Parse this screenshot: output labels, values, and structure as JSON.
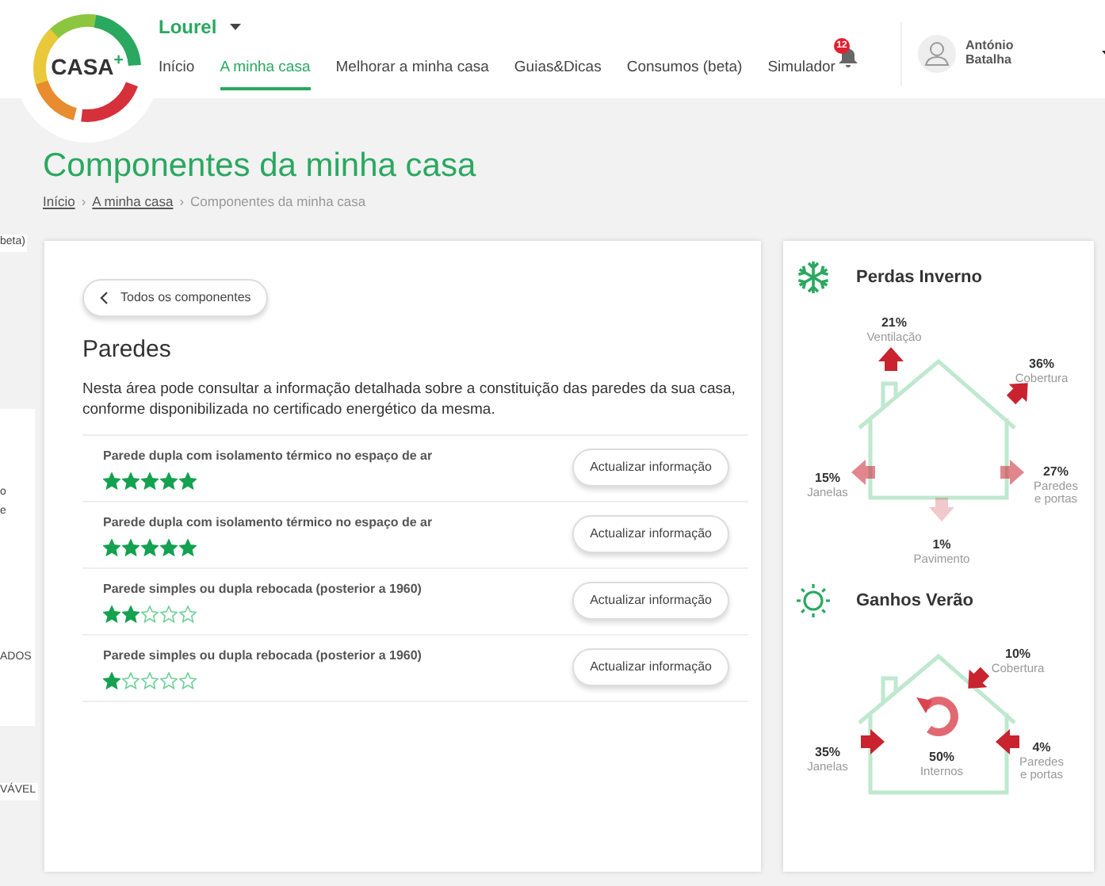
{
  "header": {
    "logo": {
      "text": "CASA",
      "sup": "+"
    },
    "location": "Lourel",
    "nav": [
      {
        "label": "Início",
        "selected": false
      },
      {
        "label": "A minha casa",
        "selected": true
      },
      {
        "label": "Melhorar a minha casa",
        "selected": false
      },
      {
        "label": "Guias&Dicas",
        "selected": false
      },
      {
        "label": "Consumos (beta)",
        "selected": false
      },
      {
        "label": "Simulador",
        "selected": false
      }
    ],
    "notifications": "12",
    "user": "António Batalha"
  },
  "side_fragments": [
    "beta)",
    "o",
    "e",
    "ADOS",
    "VÁVEL"
  ],
  "page": {
    "title": "Componentes da minha casa",
    "breadcrumb": [
      "Início",
      "A minha casa",
      "Componentes da minha casa"
    ],
    "breadcrumb_separators": [
      "›",
      "›"
    ]
  },
  "component": {
    "back": "Todos os componentes",
    "title": "Paredes",
    "description": "Nesta área pode consultar a informação detalhada sobre a constituição das paredes da sua casa, conforme disponibilizada no certificado energético da mesma.",
    "items": [
      {
        "name": "Parede dupla com isolamento térmico no espaço de ar",
        "stars": 5,
        "action": "Actualizar informação"
      },
      {
        "name": "Parede dupla com isolamento térmico no espaço de ar",
        "stars": 5,
        "action": "Actualizar informação"
      },
      {
        "name": "Parede simples ou dupla rebocada (posterior a 1960)",
        "stars": 2,
        "action": "Actualizar informação"
      },
      {
        "name": "Parede simples ou dupla rebocada (posterior a 1960)",
        "stars": 1,
        "action": "Actualizar informação"
      }
    ]
  },
  "panels": [
    {
      "kind": "winter",
      "title": "Perdas Inverno",
      "flows": [
        {
          "kind": "top",
          "value": "21%",
          "label": "Ventilação"
        },
        {
          "kind": "roof",
          "value": "36%",
          "label": "Cobertura"
        },
        {
          "kind": "left",
          "value": "15%",
          "label": "Janelas"
        },
        {
          "kind": "right",
          "value": "27%",
          "label": "Paredes e portas"
        },
        {
          "kind": "bottom",
          "value": "1%",
          "label": "Pavimento"
        }
      ]
    },
    {
      "kind": "summer",
      "title": "Ganhos Verão",
      "flows": [
        {
          "kind": "roof",
          "value": "10%",
          "label": "Cobertura"
        },
        {
          "kind": "left",
          "value": "35%",
          "label": "Janelas"
        },
        {
          "kind": "center",
          "value": "50%",
          "label": "Internos"
        },
        {
          "kind": "right",
          "value": "4%",
          "label": "Paredes e portas"
        }
      ]
    }
  ]
}
